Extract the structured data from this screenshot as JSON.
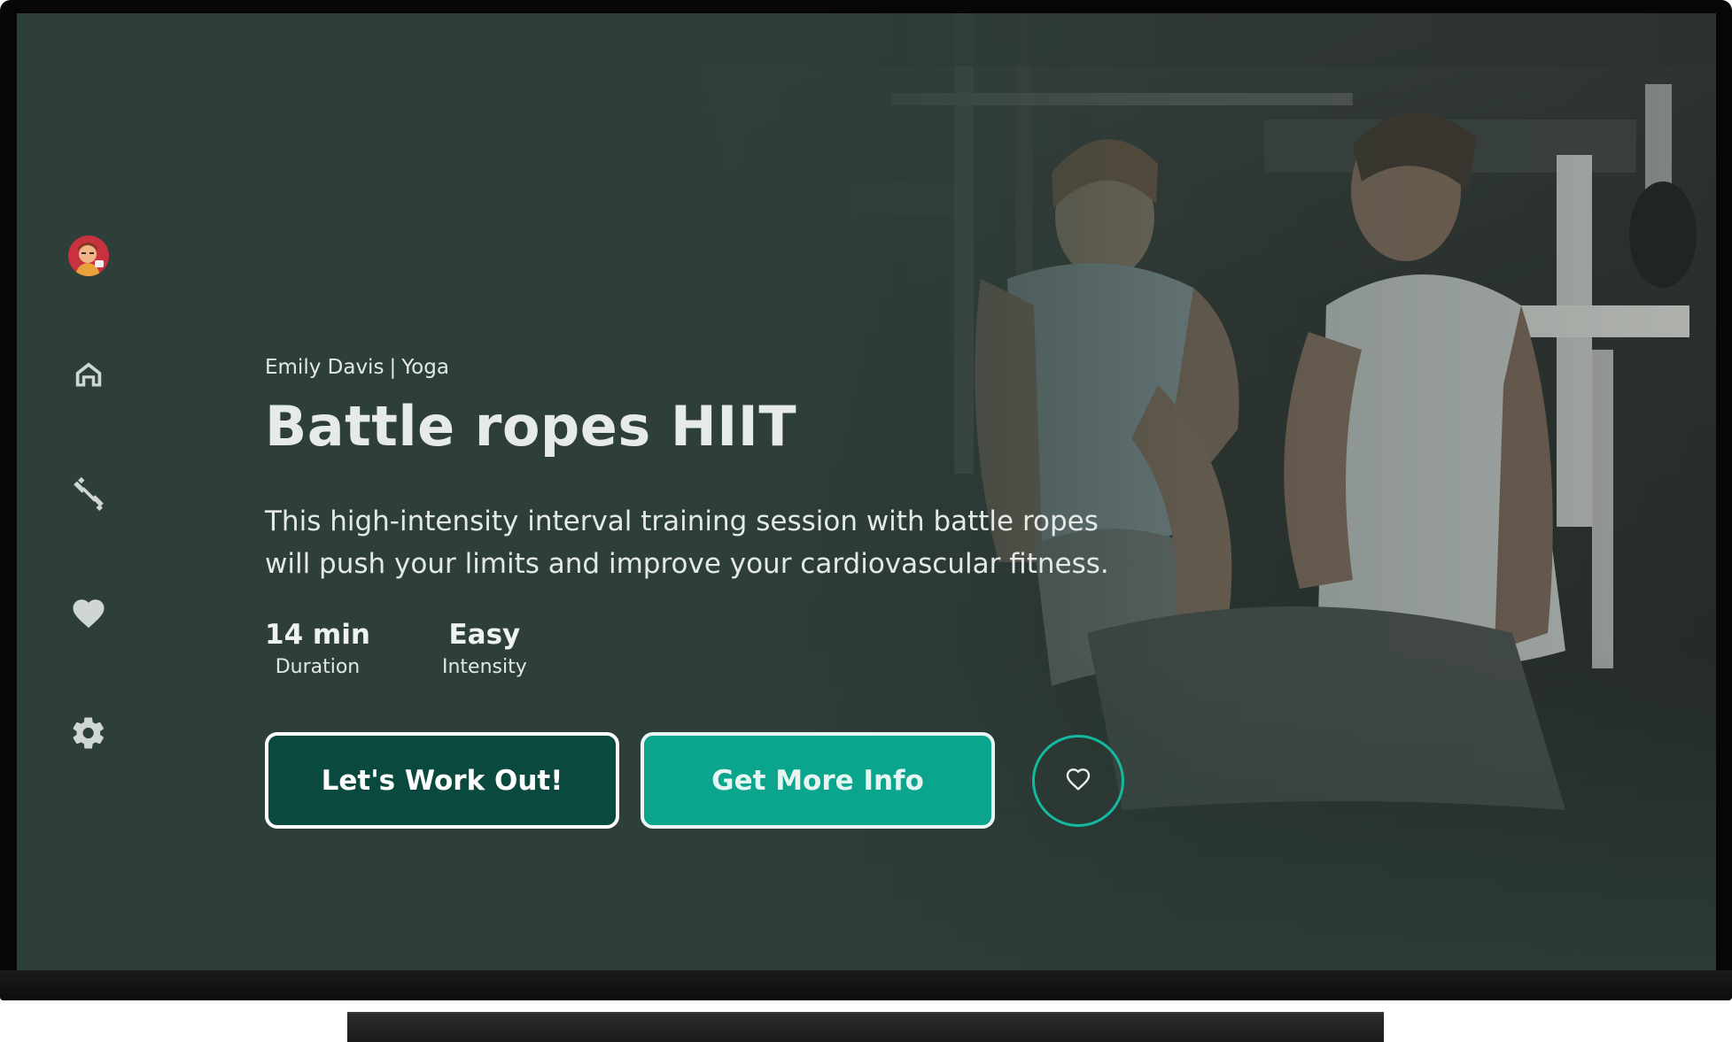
{
  "workout": {
    "instructor": "Emily Davis",
    "separator": "|",
    "category": "Yoga",
    "title": "Battle ropes HIIT",
    "description": "This high-intensity interval training session with battle ropes will push your limits and improve your cardiovascular fitness.",
    "stats": [
      {
        "value": "14 min",
        "label": "Duration"
      },
      {
        "value": "Easy",
        "label": "Intensity"
      }
    ]
  },
  "actions": {
    "primary_label": "Let's Work Out!",
    "secondary_label": "Get More Info",
    "favorite_icon": "heart-outline-icon"
  },
  "nav": {
    "items": [
      {
        "icon": "avatar",
        "label": ""
      },
      {
        "icon": "home-icon",
        "label": ""
      },
      {
        "icon": "dumbbell-icon",
        "label": ""
      },
      {
        "icon": "heart-icon",
        "label": ""
      },
      {
        "icon": "gear-icon",
        "label": ""
      }
    ]
  },
  "colors": {
    "background": "#2e3f3a",
    "primary_button": "#0a4a3e",
    "secondary_button": "#0ba58e",
    "accent_ring": "#14b89e",
    "text": "#e6ebe9"
  }
}
